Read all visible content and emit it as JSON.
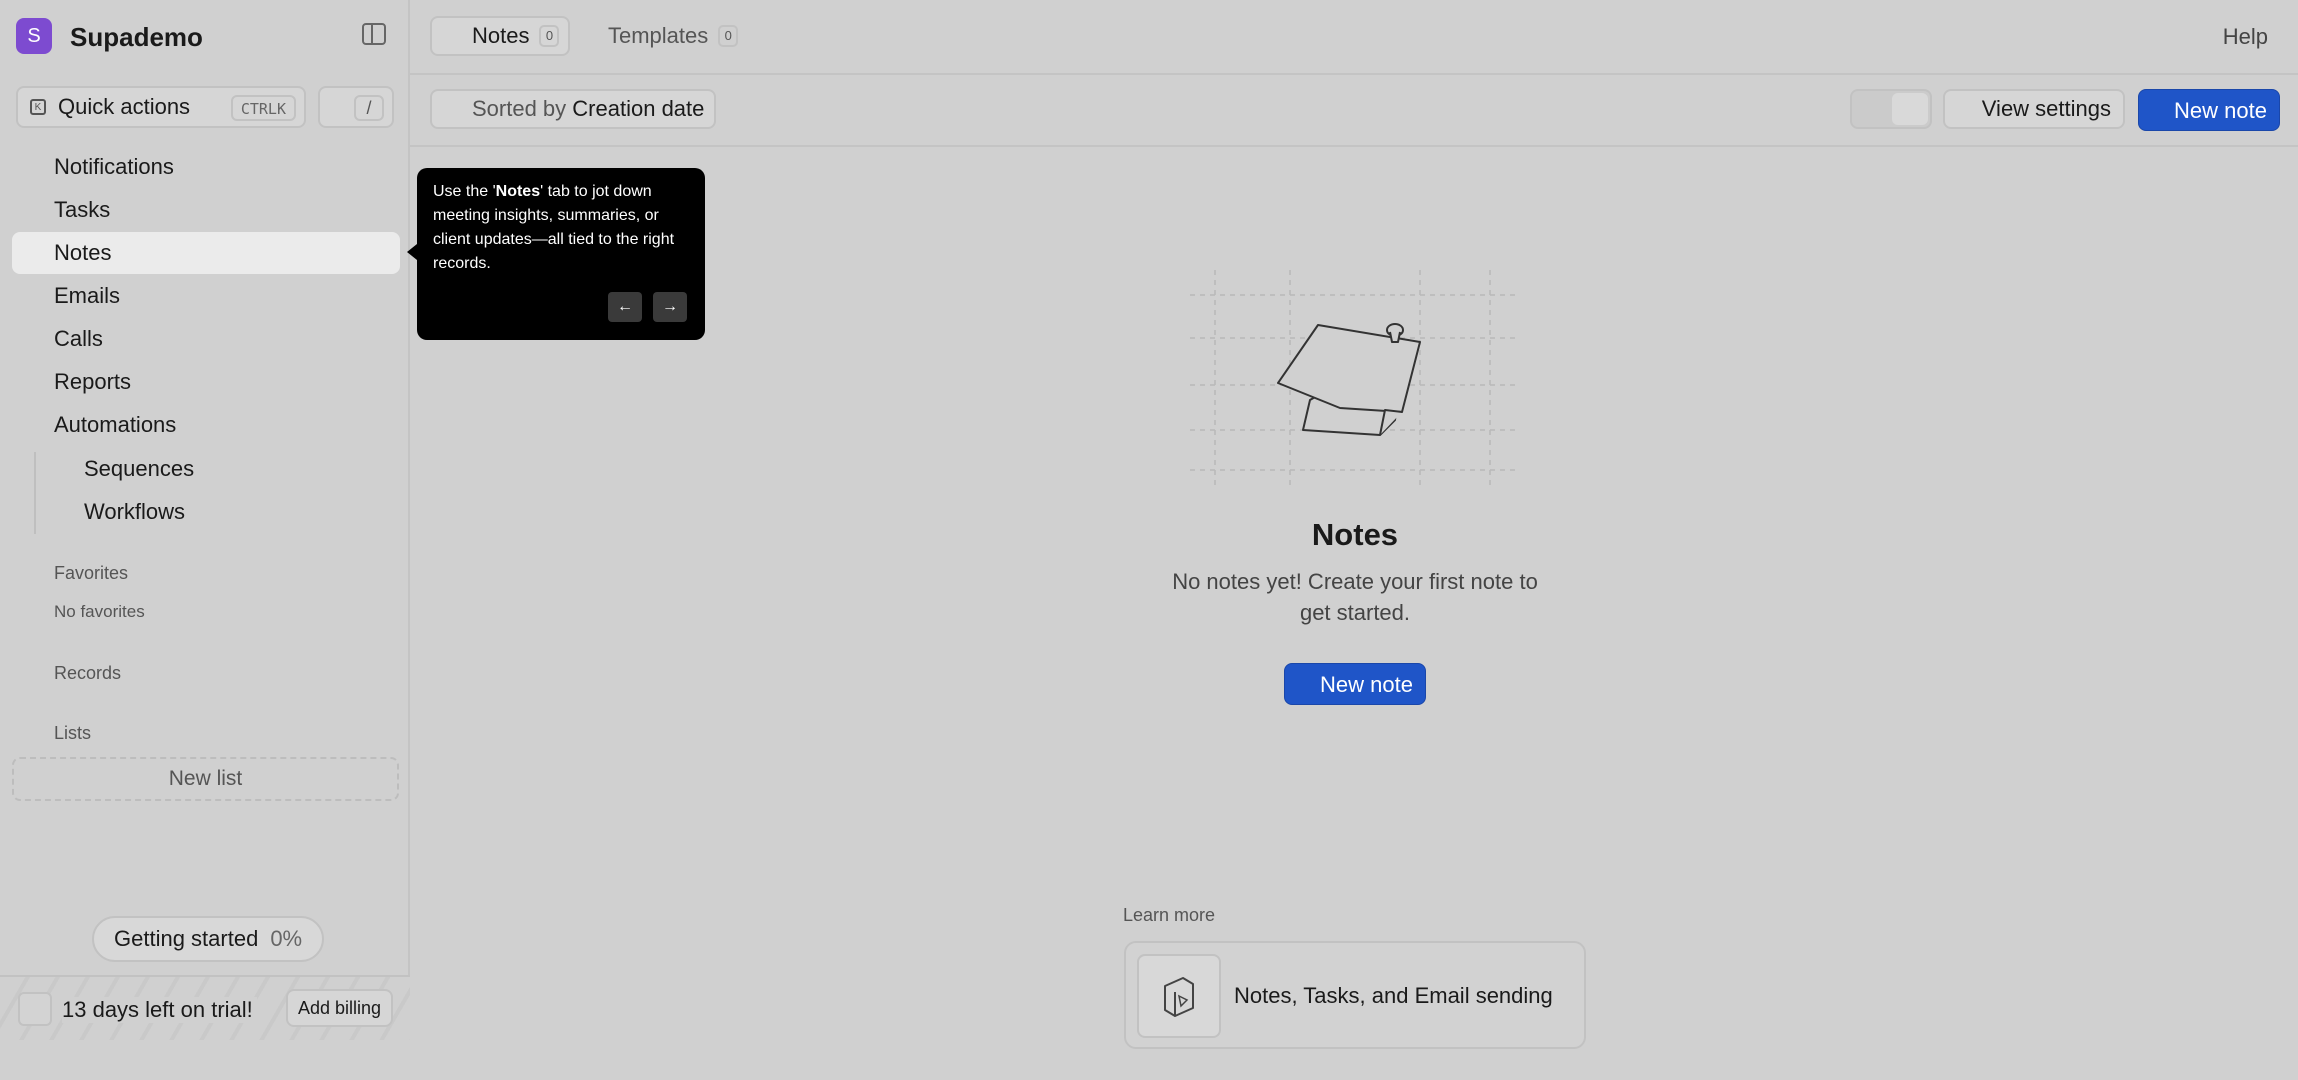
{
  "brand": {
    "initial": "S",
    "name": "Supademo"
  },
  "quick_actions": {
    "label": "Quick actions",
    "shortcut": "CTRLK",
    "slash": "/"
  },
  "nav": {
    "items": [
      {
        "label": "Notifications"
      },
      {
        "label": "Tasks"
      },
      {
        "label": "Notes",
        "active": true
      },
      {
        "label": "Emails"
      },
      {
        "label": "Calls"
      },
      {
        "label": "Reports"
      },
      {
        "label": "Automations"
      }
    ],
    "sub_items": [
      {
        "label": "Sequences"
      },
      {
        "label": "Workflows"
      }
    ]
  },
  "sections": {
    "favorites": "Favorites",
    "no_favorites": "No favorites",
    "records": "Records",
    "lists": "Lists",
    "new_list": "New list"
  },
  "getting_started": {
    "label": "Getting started",
    "percent": "0%"
  },
  "trial": {
    "text": "13 days left on trial!",
    "billing_button": "Add billing"
  },
  "tabs": [
    {
      "label": "Notes",
      "count": "0",
      "active": true
    },
    {
      "label": "Templates",
      "count": "0",
      "active": false
    }
  ],
  "help": "Help",
  "toolbar": {
    "sort_prefix": "Sorted by",
    "sort_value": "Creation date",
    "view_settings": "View settings",
    "new_note": "New note"
  },
  "tooltip": {
    "text_before": "Use the '",
    "text_bold": "Notes",
    "text_after": "' tab to jot down meeting insights, summaries, or client updates—all tied to the right records.",
    "prev_icon": "←",
    "next_icon": "→"
  },
  "empty_state": {
    "title": "Notes",
    "description": "No notes yet! Create your first note to get started.",
    "button": "New note"
  },
  "learn_more": {
    "label": "Learn more",
    "card_title": "Notes, Tasks, and Email sending"
  },
  "colors": {
    "accent": "#1f55c8",
    "brand": "#7d4bd0",
    "background": "#d0d0d0",
    "active_nav": "#ebebeb"
  }
}
